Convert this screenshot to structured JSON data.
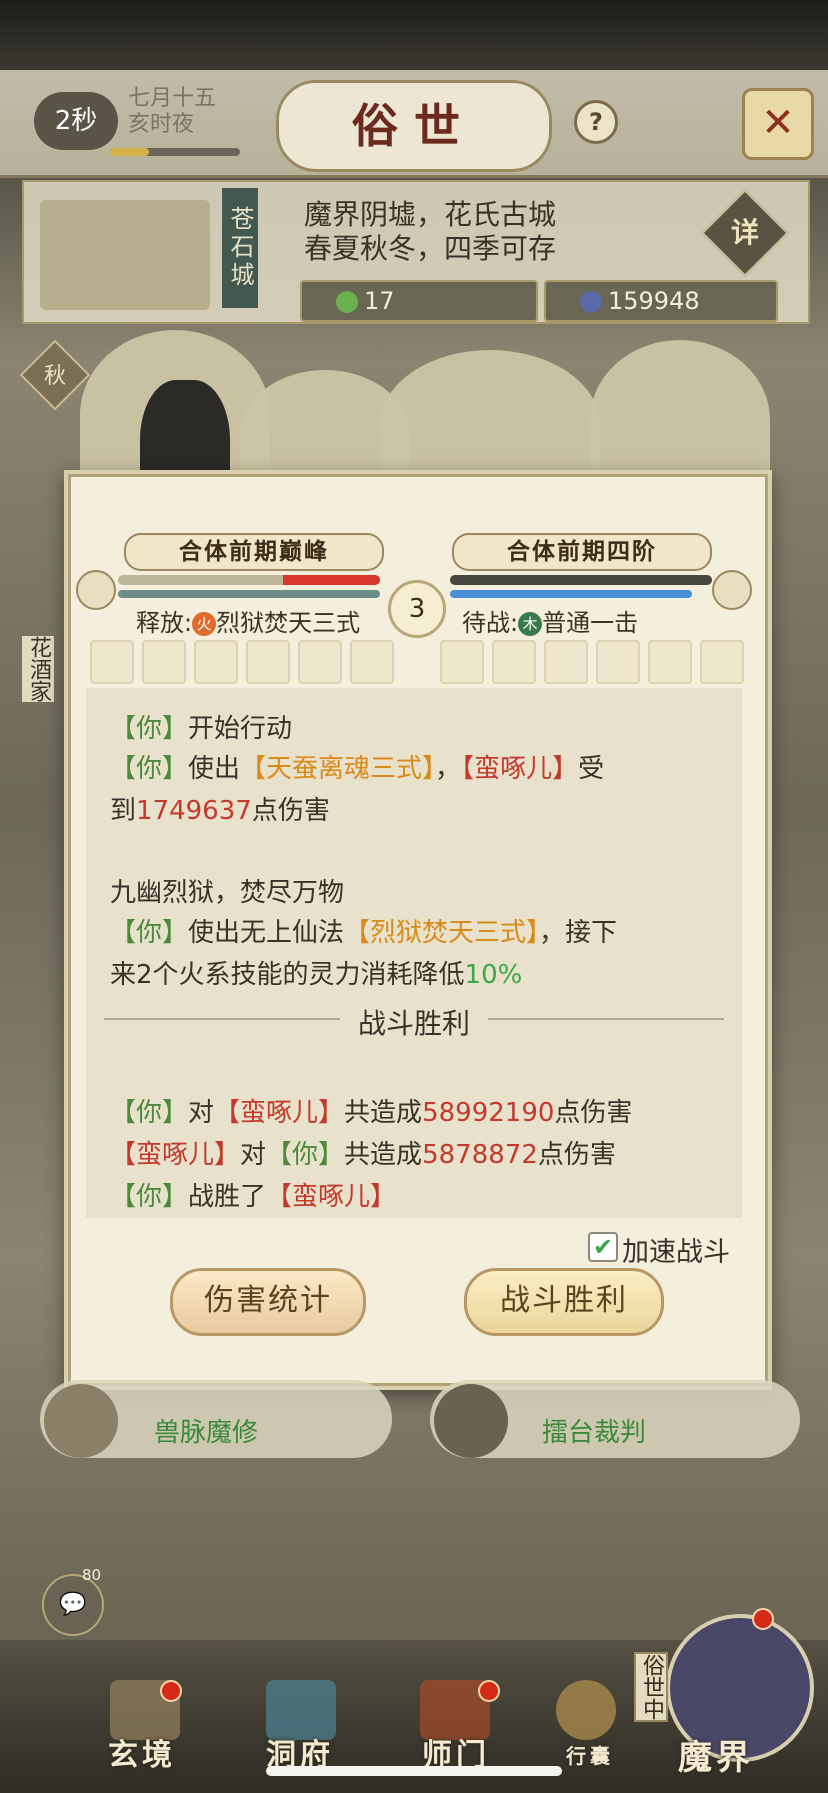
{
  "header": {
    "timer": "2秒",
    "date_line1": "七月十五",
    "date_line2": "亥时夜",
    "title": "俗世",
    "help": "?",
    "close": "✕"
  },
  "location": {
    "city": "苍石城",
    "desc_line1": "魔界阴墟，花氏古城",
    "desc_line2": "春夏秋冬，四季可存",
    "detail_button": "详",
    "resource_1": "17",
    "resource_2": "159948",
    "season_badge": "秋",
    "side_sign": "花酒家"
  },
  "battle": {
    "left_rank": "合体前期巅峰",
    "right_rank": "合体前期四阶",
    "left_hp_fraction": 0.37,
    "right_hp_fraction": 1.0,
    "round": "3",
    "left_skill_prefix": "释放:",
    "left_skill_elem": "火",
    "left_skill_name": "烈狱焚天三式",
    "right_skill_prefix": "待战:",
    "right_skill_elem": "木",
    "right_skill_name": "普通一击"
  },
  "log": {
    "l1_you": "【你】",
    "l1_text": "开始行动",
    "l2_you": "【你】",
    "l2_a": "使出",
    "l2_skill": "【天蚕离魂三式】",
    "l2_b": "，",
    "l2_enemy": "【蛮啄儿】",
    "l2_c": "受",
    "l3_a": "到",
    "l3_dmg": "1749637",
    "l3_b": "点伤害",
    "l4_text": "九幽烈狱，焚尽万物",
    "l5_you": "【你】",
    "l5_a": "使出无上仙法",
    "l5_skill": "【烈狱焚天三式】",
    "l5_b": "，接下",
    "l6_a": "来2个火系技能的灵力消耗降低",
    "l6_pct": "10%",
    "divider": "战斗胜利",
    "s1_you": "【你】",
    "s1_a": "对",
    "s1_enemy": "【蛮啄儿】",
    "s1_b": "共造成",
    "s1_dmg": "58992190",
    "s1_c": "点伤害",
    "s2_enemy": "【蛮啄儿】",
    "s2_a": "对",
    "s2_you": "【你】",
    "s2_b": "共造成",
    "s2_dmg": "5878872",
    "s2_c": "点伤害",
    "s3_you": "【你】",
    "s3_a": "战胜了",
    "s3_enemy": "【蛮啄儿】"
  },
  "controls": {
    "speedup_label": "加速战斗",
    "speedup_checked": true,
    "damage_stats_button": "伤害统计",
    "victory_button": "战斗胜利"
  },
  "cards": {
    "left_role": "兽脉魔修",
    "right_role": "擂台裁判"
  },
  "chat": {
    "badge": "80"
  },
  "nav": {
    "items": [
      "玄境",
      "洞府",
      "师门",
      "行囊",
      "魔界"
    ],
    "vertical": "俗世中"
  },
  "colors": {
    "you": "#4c8a3a",
    "enemy": "#c33a2c",
    "skill": "#d88a1a",
    "percent": "#3aa848"
  }
}
